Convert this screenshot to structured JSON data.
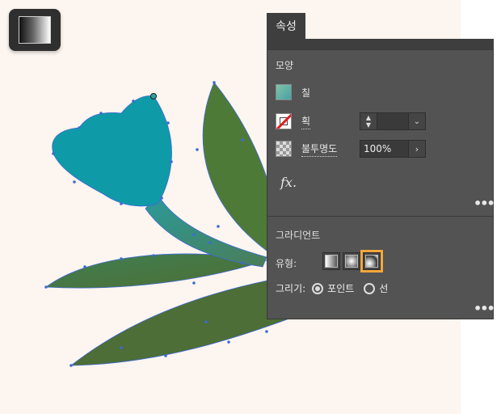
{
  "tool": {
    "icon": "gradient-tool-icon"
  },
  "panel": {
    "tab_label": "속성",
    "appearance": {
      "title": "모양",
      "fill_label": "칠",
      "stroke_label": "획",
      "opacity_label": "불투명도",
      "opacity_value": "100%",
      "fx_label": "fx."
    },
    "gradient": {
      "title": "그라디언트",
      "type_label": "유형:",
      "draw_label": "그리기:",
      "draw_options": [
        "포인트",
        "선"
      ],
      "selected_draw": "포인트",
      "selected_type": "freeform"
    }
  },
  "colors": {
    "canvas": "#fdf5ef",
    "panel": "#535353",
    "accent": "#f2a83b",
    "flower": "#0f9aa8",
    "leaf": "#4f7a3c"
  }
}
